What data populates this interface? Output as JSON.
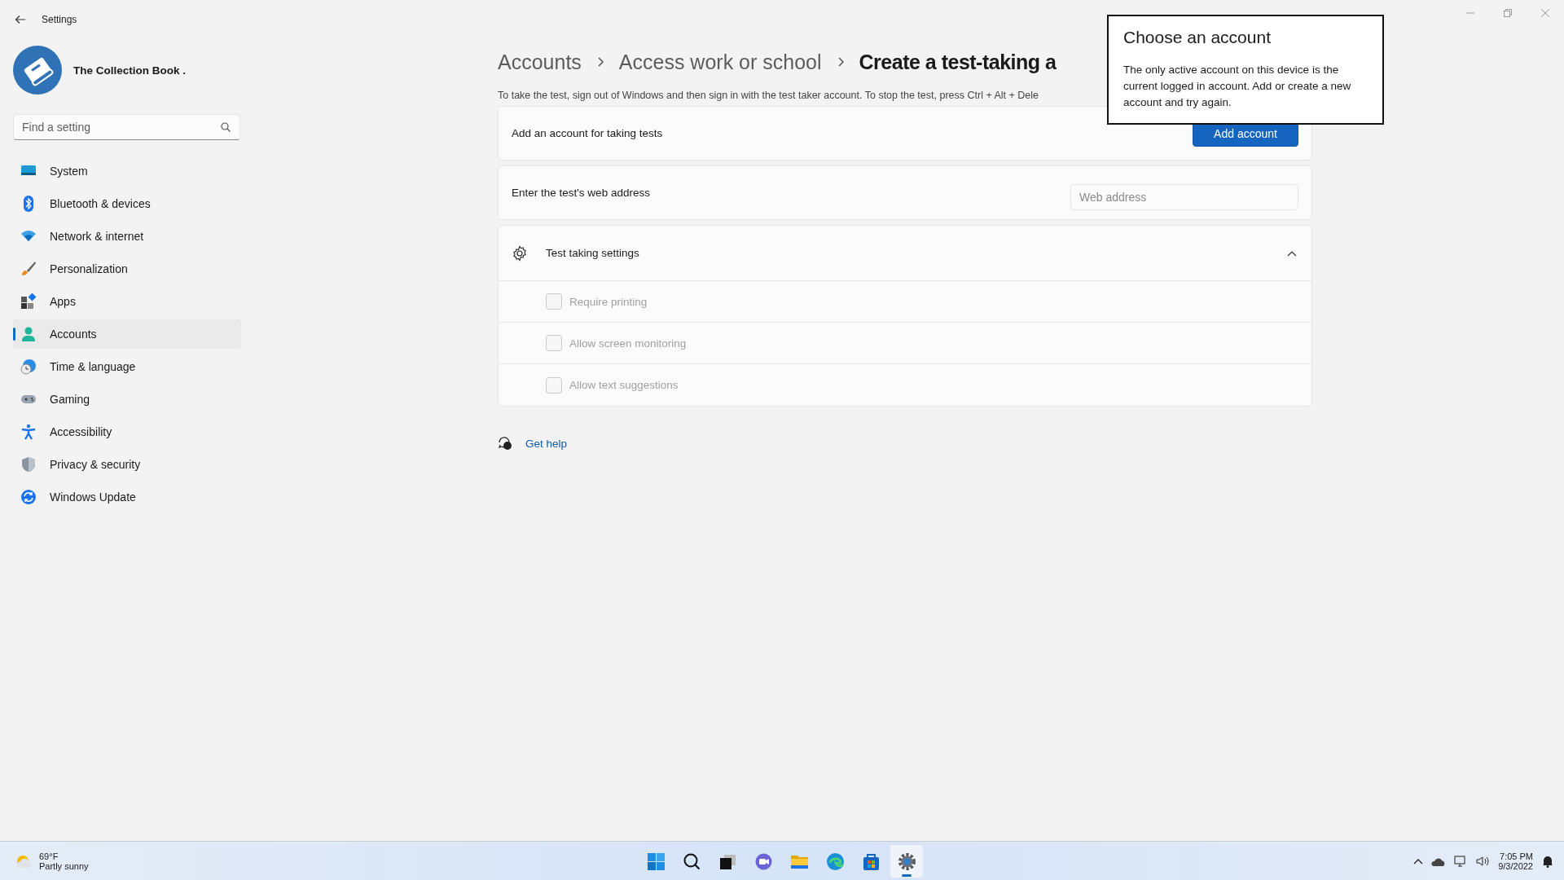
{
  "window": {
    "title": "Settings"
  },
  "profile": {
    "name": "The Collection Book ."
  },
  "search": {
    "placeholder": "Find a setting"
  },
  "sidebar": {
    "items": [
      {
        "label": "System",
        "selected": false
      },
      {
        "label": "Bluetooth & devices",
        "selected": false
      },
      {
        "label": "Network & internet",
        "selected": false
      },
      {
        "label": "Personalization",
        "selected": false
      },
      {
        "label": "Apps",
        "selected": false
      },
      {
        "label": "Accounts",
        "selected": true
      },
      {
        "label": "Time & language",
        "selected": false
      },
      {
        "label": "Gaming",
        "selected": false
      },
      {
        "label": "Accessibility",
        "selected": false
      },
      {
        "label": "Privacy & security",
        "selected": false
      },
      {
        "label": "Windows Update",
        "selected": false
      }
    ]
  },
  "breadcrumb": [
    "Accounts",
    "Access work or school",
    "Create a test-taking a"
  ],
  "description": "To take the test, sign out of Windows and then sign in with the test taker account. To stop the test, press Ctrl + Alt + Dele",
  "cards": [
    {
      "kind": "button",
      "label": "Add an account for taking tests",
      "button": "Add account"
    },
    {
      "kind": "field",
      "label": "Enter the test's web address",
      "placeholder": "Web address"
    }
  ],
  "expander": {
    "title": "Test taking settings",
    "expanded": true,
    "options": [
      {
        "label": "Require printing",
        "checked": false,
        "disabled": true
      },
      {
        "label": "Allow screen monitoring",
        "checked": false,
        "disabled": true
      },
      {
        "label": "Allow text suggestions",
        "checked": false,
        "disabled": true
      }
    ]
  },
  "help_link": "Get help",
  "popup": {
    "title": "Choose an account",
    "message": "The only active account on this device is the current logged in account. Add or create a new account and try again."
  },
  "taskbar": {
    "weather": {
      "temperature": "69°F",
      "condition": "Partly sunny"
    },
    "apps": [
      {
        "selected": false
      },
      {
        "selected": false
      },
      {
        "selected": false
      },
      {
        "selected": false
      },
      {
        "selected": false
      },
      {
        "selected": false
      },
      {
        "selected": false
      },
      {
        "selected": true
      }
    ],
    "time": "7:05 PM",
    "date": "9/3/2022"
  }
}
